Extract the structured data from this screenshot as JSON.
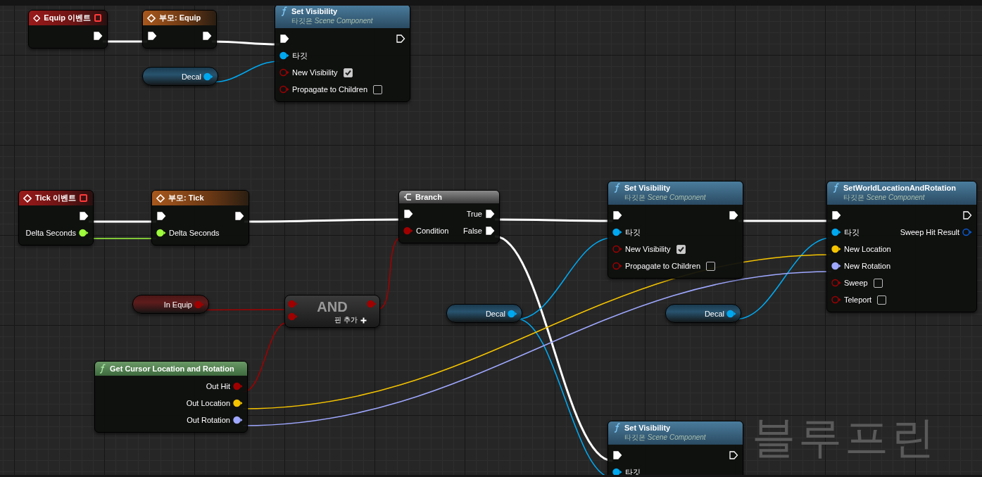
{
  "graph_label": "블루프린",
  "nodes": [
    {
      "kind": "event",
      "title": "Equip 이벤트",
      "rows": [
        {
          "out": {
            "kind": "exec",
            "connected": true
          }
        }
      ]
    },
    {
      "kind": "parent",
      "title": "부모: Equip",
      "rows": [
        {
          "in": {
            "kind": "exec",
            "connected": true
          },
          "out": {
            "kind": "exec",
            "connected": true
          }
        }
      ]
    },
    {
      "kind": "function",
      "title": "Set Visibility",
      "subtitle": "타깃은 *Scene Component*",
      "rows": [
        {
          "in": {
            "kind": "exec",
            "connected": true
          },
          "out": {
            "kind": "exec",
            "connected": false
          }
        },
        {
          "in": {
            "kind": "object",
            "label": "타깃",
            "connected": true
          }
        },
        {
          "in": {
            "kind": "bool",
            "label": "New Visibility",
            "checked": true,
            "connected": false
          }
        },
        {
          "in": {
            "kind": "bool",
            "label": "Propagate to Children",
            "checked": false,
            "connected": false
          }
        }
      ]
    },
    {
      "kind": "getter",
      "title": "Decal",
      "rows": [
        {
          "out": {
            "kind": "object",
            "connected": true
          }
        }
      ]
    },
    {
      "kind": "event",
      "title": "Tick 이벤트",
      "rows": [
        {
          "out": {
            "kind": "exec",
            "connected": true
          }
        },
        {
          "out": {
            "kind": "float",
            "label": "Delta Seconds",
            "connected": true
          }
        }
      ]
    },
    {
      "kind": "parent",
      "title": "부모: Tick",
      "rows": [
        {
          "in": {
            "kind": "exec",
            "connected": true
          },
          "out": {
            "kind": "exec",
            "connected": true
          }
        },
        {
          "in": {
            "kind": "float",
            "label": "Delta Seconds",
            "connected": true
          }
        }
      ]
    },
    {
      "kind": "branch",
      "title": "Branch",
      "rows": [
        {
          "in": {
            "kind": "exec",
            "connected": true
          },
          "out": {
            "kind": "exec",
            "label": "True",
            "connected": true
          }
        },
        {
          "in": {
            "kind": "bool",
            "label": "Condition",
            "connected": true
          },
          "out": {
            "kind": "exec",
            "label": "False",
            "connected": true
          }
        }
      ]
    },
    {
      "kind": "function",
      "title": "Set Visibility",
      "subtitle": "타깃은 *Scene Component*",
      "rows": [
        {
          "in": {
            "kind": "exec",
            "connected": true
          },
          "out": {
            "kind": "exec",
            "connected": true
          }
        },
        {
          "in": {
            "kind": "object",
            "label": "타깃",
            "connected": true
          }
        },
        {
          "in": {
            "kind": "bool",
            "label": "New Visibility",
            "checked": true,
            "connected": false
          }
        },
        {
          "in": {
            "kind": "bool",
            "label": "Propagate to Children",
            "checked": false,
            "connected": false
          }
        }
      ]
    },
    {
      "kind": "function",
      "title": "SetWorldLocationAndRotation",
      "subtitle": "타깃은 *Scene Component*",
      "rows": [
        {
          "in": {
            "kind": "exec",
            "connected": true
          },
          "out": {
            "kind": "exec",
            "connected": false
          }
        },
        {
          "in": {
            "kind": "object",
            "label": "타깃",
            "connected": true
          },
          "out": {
            "kind": "struct",
            "label": "Sweep Hit Result",
            "connected": false
          }
        },
        {
          "in": {
            "kind": "vector",
            "label": "New Location",
            "connected": true
          }
        },
        {
          "in": {
            "kind": "rotator",
            "label": "New Rotation",
            "connected": true
          }
        },
        {
          "in": {
            "kind": "bool",
            "label": "Sweep",
            "checked": false,
            "connected": false
          }
        },
        {
          "in": {
            "kind": "bool",
            "label": "Teleport",
            "checked": false,
            "connected": false
          }
        }
      ]
    },
    {
      "kind": "getter",
      "title": "In Equip",
      "rows": [
        {
          "out": {
            "kind": "bool",
            "connected": true
          }
        }
      ]
    },
    {
      "kind": "operator",
      "title": "AND",
      "add_pin": "핀 추가",
      "rows": [
        {
          "in": {
            "kind": "bool",
            "connected": true
          },
          "out": {
            "kind": "bool",
            "connected": true
          }
        },
        {
          "in": {
            "kind": "bool",
            "connected": true
          }
        }
      ]
    },
    {
      "kind": "getter",
      "title": "Decal",
      "rows": [
        {
          "out": {
            "kind": "object",
            "connected": true
          }
        }
      ]
    },
    {
      "kind": "getter",
      "title": "Decal",
      "rows": [
        {
          "out": {
            "kind": "object",
            "connected": true
          }
        }
      ]
    },
    {
      "kind": "pure",
      "title": "Get Cursor Location and Rotation",
      "rows": [
        {
          "out": {
            "kind": "bool",
            "label": "Out Hit",
            "connected": true
          }
        },
        {
          "out": {
            "kind": "vector",
            "label": "Out Location",
            "connected": true
          }
        },
        {
          "out": {
            "kind": "rotator",
            "label": "Out Rotation",
            "connected": true
          }
        }
      ]
    },
    {
      "kind": "function",
      "title": "Set Visibility",
      "subtitle": "타깃은 *Scene Component*",
      "rows": [
        {
          "in": {
            "kind": "exec",
            "connected": true
          },
          "out": {
            "kind": "exec",
            "connected": false
          }
        },
        {
          "in": {
            "kind": "object",
            "label": "타깃",
            "connected": true
          }
        }
      ]
    }
  ]
}
